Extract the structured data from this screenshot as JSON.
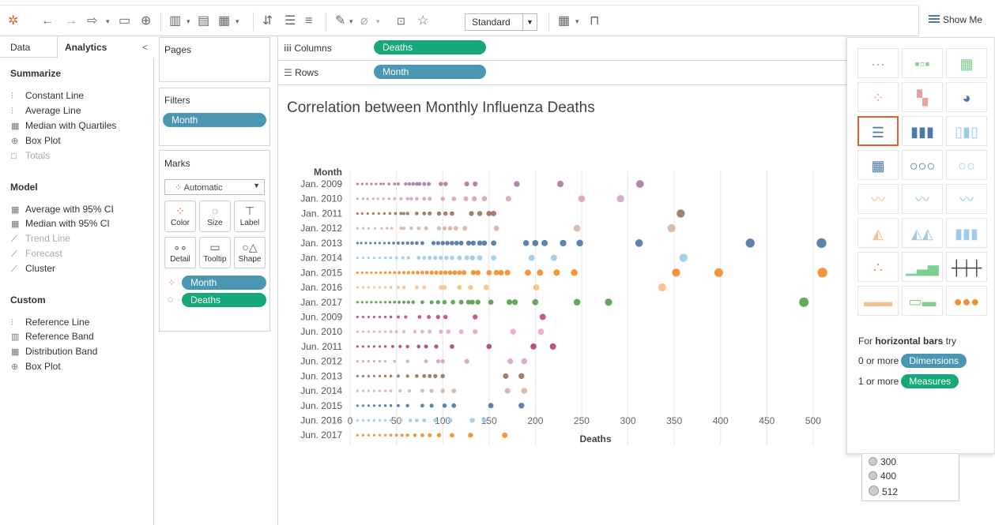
{
  "toolbar": {
    "mark_size_label": "Standard",
    "show_me_label": "Show Me"
  },
  "left_panel": {
    "tab_data": "Data",
    "tab_analytics": "Analytics",
    "collapse": "<",
    "summarize_title": "Summarize",
    "summarize_items": [
      "Constant Line",
      "Average Line",
      "Median with Quartiles",
      "Box Plot",
      "Totals"
    ],
    "model_title": "Model",
    "model_items": [
      "Average with 95% CI",
      "Median with 95% CI",
      "Trend Line",
      "Forecast",
      "Cluster"
    ],
    "custom_title": "Custom",
    "custom_items": [
      "Reference Line",
      "Reference Band",
      "Distribution Band",
      "Box Plot"
    ]
  },
  "cards": {
    "pages_title": "Pages",
    "filters_title": "Filters",
    "filter_pill": "Month",
    "marks_title": "Marks",
    "marks_type": "Automatic",
    "mark_buttons": [
      "Color",
      "Size",
      "Label",
      "Detail",
      "Tooltip",
      "Shape"
    ],
    "mark_pills": [
      "Month",
      "Deaths"
    ]
  },
  "shelves": {
    "columns_label": "Columns",
    "columns_pill": "Deaths",
    "rows_label": "Rows",
    "rows_pill": "Month"
  },
  "chart_data": {
    "type": "scatter",
    "title": "Correlation between Monthly Influenza Deaths",
    "xlabel": "Deaths",
    "ylabel": "Month",
    "xlim": [
      0,
      512
    ],
    "x_ticks": [
      0,
      50,
      100,
      150,
      200,
      250,
      300,
      350,
      400,
      450,
      500
    ],
    "grid": true,
    "categories": [
      "Jan. 2009",
      "Jan. 2010",
      "Jan. 2011",
      "Jan. 2012",
      "Jan. 2013",
      "Jan. 2014",
      "Jan. 2015",
      "Jan. 2016",
      "Jan. 2017",
      "Jun. 2009",
      "Jun. 2010",
      "Jun. 2011",
      "Jun. 2012",
      "Jun. 2013",
      "Jun. 2014",
      "Jun. 2015",
      "Jun. 2016",
      "Jun. 2017"
    ],
    "colors": [
      "#b07aa1",
      "#d4a6c8",
      "#9c755f",
      "#d7b5a6",
      "#4e79a7",
      "#a0cbe8",
      "#f28e2b",
      "#ffbe7d",
      "#59a14f",
      "#c44e7a",
      "#f1a7c0",
      "#b04677",
      "#d9a3cc",
      "#9c755f",
      "#d7b5a6",
      "#4e79a7",
      "#a0cbe8",
      "#f28e2b"
    ],
    "series": [
      {
        "name": "Jan. 2009",
        "values": [
          8,
          13,
          18,
          23,
          28,
          33,
          36,
          42,
          48,
          52,
          60,
          64,
          68,
          72,
          75,
          80,
          85,
          98,
          103,
          126,
          135,
          180,
          227,
          313
        ]
      },
      {
        "name": "Jan. 2010",
        "values": [
          8,
          14,
          19,
          25,
          30,
          36,
          42,
          48,
          55,
          62,
          66,
          72,
          80,
          86,
          100,
          112,
          125,
          134,
          145,
          171,
          250,
          292
        ]
      },
      {
        "name": "Jan. 2011",
        "values": [
          8,
          13,
          19,
          25,
          31,
          37,
          43,
          49,
          55,
          58,
          62,
          72,
          80,
          86,
          96,
          103,
          110,
          131,
          140,
          150,
          155,
          357
        ]
      },
      {
        "name": "Jan. 2012",
        "values": [
          8,
          14,
          20,
          27,
          34,
          40,
          45,
          55,
          58,
          66,
          74,
          82,
          96,
          102,
          108,
          114,
          124,
          158,
          245,
          347
        ]
      },
      {
        "name": "Jan. 2013",
        "values": [
          8,
          12,
          17,
          22,
          27,
          32,
          37,
          42,
          47,
          52,
          57,
          62,
          67,
          72,
          78,
          90,
          95,
          100,
          105,
          110,
          115,
          120,
          128,
          133,
          140,
          145,
          155,
          190,
          200,
          210,
          230,
          248,
          312,
          432,
          509
        ]
      },
      {
        "name": "Jan. 2014",
        "values": [
          8,
          14,
          20,
          26,
          32,
          38,
          44,
          50,
          57,
          63,
          74,
          80,
          86,
          92,
          98,
          104,
          110,
          118,
          126,
          132,
          140,
          155,
          196,
          220,
          360
        ]
      },
      {
        "name": "Jan. 2015",
        "values": [
          8,
          13,
          18,
          23,
          28,
          33,
          38,
          43,
          48,
          53,
          58,
          63,
          68,
          73,
          78,
          83,
          88,
          93,
          98,
          103,
          108,
          113,
          118,
          123,
          133,
          138,
          150,
          158,
          163,
          170,
          192,
          205,
          223,
          242,
          352,
          398,
          510
        ]
      },
      {
        "name": "Jan. 2016",
        "values": [
          8,
          14,
          20,
          26,
          32,
          38,
          44,
          52,
          58,
          72,
          80,
          98,
          102,
          118,
          130,
          147,
          201,
          337
        ]
      },
      {
        "name": "Jan. 2017",
        "values": [
          8,
          13,
          18,
          23,
          28,
          33,
          38,
          43,
          48,
          53,
          58,
          63,
          68,
          78,
          88,
          95,
          102,
          111,
          120,
          128,
          132,
          138,
          152,
          172,
          178,
          200,
          245,
          279,
          490
        ]
      },
      {
        "name": "Jun. 2009",
        "values": [
          8,
          14,
          20,
          26,
          32,
          38,
          44,
          52,
          60,
          75,
          85,
          95,
          103,
          135,
          208
        ]
      },
      {
        "name": "Jun. 2010",
        "values": [
          8,
          14,
          20,
          26,
          32,
          38,
          44,
          50,
          58,
          70,
          78,
          86,
          98,
          106,
          120,
          135,
          176,
          206
        ]
      },
      {
        "name": "Jun. 2011",
        "values": [
          8,
          14,
          20,
          26,
          32,
          38,
          46,
          54,
          62,
          74,
          82,
          93,
          110,
          150,
          198,
          219
        ]
      },
      {
        "name": "Jun. 2012",
        "values": [
          8,
          14,
          20,
          26,
          32,
          38,
          48,
          62,
          82,
          95,
          100,
          126,
          173,
          188
        ]
      },
      {
        "name": "Jun. 2013",
        "values": [
          8,
          14,
          20,
          26,
          32,
          38,
          44,
          52,
          62,
          72,
          80,
          86,
          92,
          100,
          168,
          185
        ]
      },
      {
        "name": "Jun. 2014",
        "values": [
          8,
          14,
          20,
          26,
          32,
          38,
          44,
          54,
          64,
          78,
          88,
          100,
          112,
          170,
          188
        ]
      },
      {
        "name": "Jun. 2015",
        "values": [
          8,
          14,
          20,
          26,
          32,
          38,
          44,
          52,
          62,
          78,
          88,
          102,
          112,
          152,
          185
        ]
      },
      {
        "name": "Jun. 2016",
        "values": [
          8,
          14,
          20,
          26,
          32,
          38,
          44,
          55,
          65,
          72,
          80,
          92,
          108,
          132,
          145
        ]
      },
      {
        "name": "Jun. 2017",
        "values": [
          8,
          14,
          20,
          26,
          32,
          38,
          44,
          50,
          56,
          62,
          70,
          78,
          86,
          96,
          110,
          130,
          167
        ]
      }
    ]
  },
  "show_me": {
    "hint_prefix": "For",
    "hint_bold": "horizontal bars",
    "hint_suffix": "try",
    "dim_req": "0 or more",
    "dim_tag": "Dimensions",
    "meas_req": "1 or more",
    "meas_tag": "Measures"
  },
  "size_legend": [
    "300",
    "400",
    "512"
  ]
}
